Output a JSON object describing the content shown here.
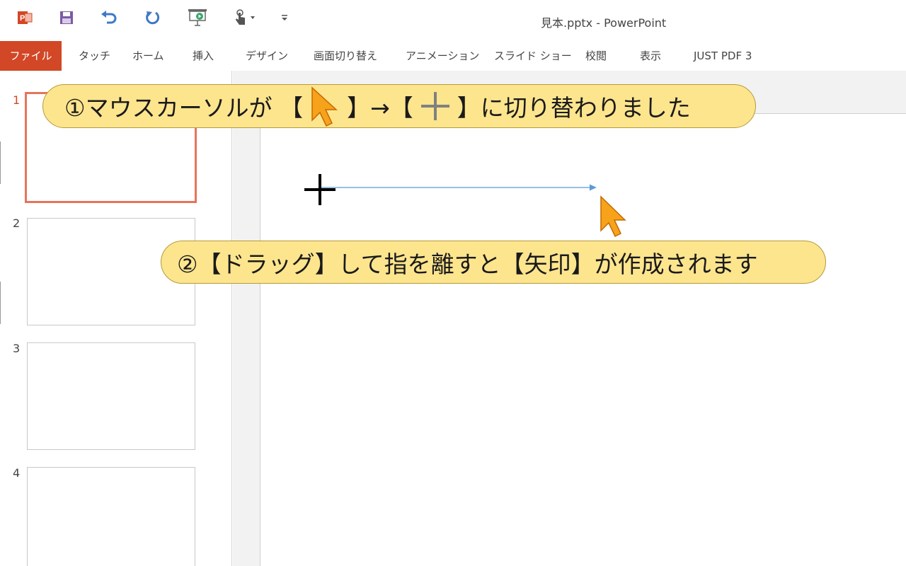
{
  "window": {
    "title": "見本.pptx - PowerPoint"
  },
  "qat": {
    "items": [
      "powerpoint-logo",
      "save",
      "undo",
      "redo",
      "start-from-beginning",
      "touch-mouse-mode",
      "customize"
    ]
  },
  "ribbon": {
    "file_label": "ファイル",
    "tabs": [
      "タッチ",
      "ホーム",
      "挿入",
      "デザイン",
      "画面切り替え",
      "アニメーション",
      "スライド ショー",
      "校閲",
      "表示",
      "JUST PDF 3"
    ]
  },
  "thumbnails": {
    "numbers": [
      "1",
      "2",
      "3",
      "4"
    ],
    "selected": "1"
  },
  "callouts": {
    "first": {
      "prefix": "①マウスカーソルが 【",
      "middle": "】→【",
      "suffix": "】に切り替わりました"
    },
    "second": {
      "text": "②【ドラッグ】して指を離すと【矢印】が作成されます"
    }
  },
  "colors": {
    "accent": "#d24726",
    "callout_fill": "#fde58e",
    "arrow_line": "#5b9bd5",
    "cursor_fill": "#f7a21b"
  }
}
